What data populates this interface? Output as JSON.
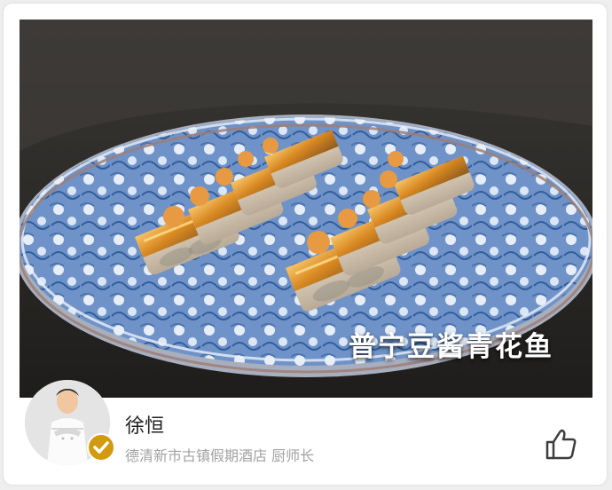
{
  "dish": {
    "title": "普宁豆酱青花鱼"
  },
  "chef": {
    "name": "徐恒",
    "title": "德清新市古镇假期酒店 厨师长"
  },
  "icons": {
    "verified": "checkmark-icon",
    "like": "thumbs-up-icon"
  },
  "colors": {
    "verified_badge": "#d29a10",
    "plate_blue": "#5b7fb7",
    "background_card": "#ffffff"
  }
}
